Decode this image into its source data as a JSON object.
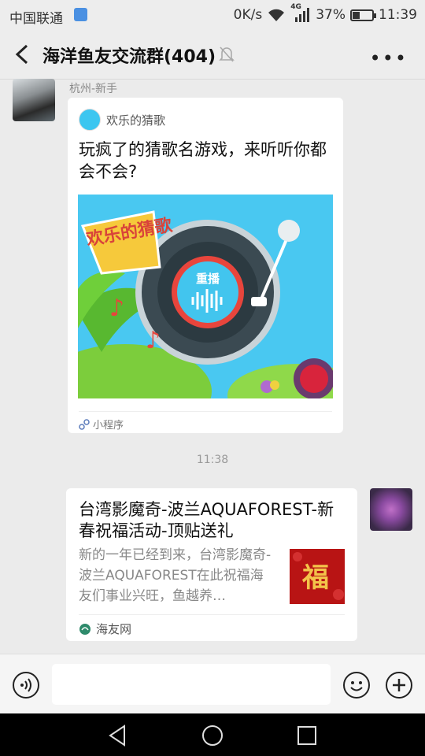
{
  "status_bar": {
    "carrier": "中国联通",
    "speed": "0K/s",
    "network": "4G",
    "battery": "37%",
    "battery_level": 0.37,
    "time": "11:39"
  },
  "nav": {
    "title": "海洋鱼友交流群(404)"
  },
  "messages": {
    "msg1": {
      "sender": "杭州-新手",
      "app_name": "欢乐的猜歌",
      "title": "玩疯了的猜歌名游戏，来听听你都会不会?",
      "image_logo_text": "欢乐的猜歌",
      "image_button": "重播",
      "footer": "小程序"
    },
    "timestamp": "11:38",
    "msg2": {
      "title": "台湾影魔奇-波兰AQUAFOREST-新春祝福活动-顶贴送礼",
      "desc": "新的一年已经到来，台湾影魔奇-波兰AQUAFOREST在此祝福海友们事业兴旺，鱼越养…",
      "thumb_text": "福",
      "source": "海友网"
    }
  },
  "colors": {
    "bubble": "#ffffff",
    "background": "#ebebeb",
    "game_sky": "#49c8f1",
    "accent_red": "#e8453c"
  }
}
